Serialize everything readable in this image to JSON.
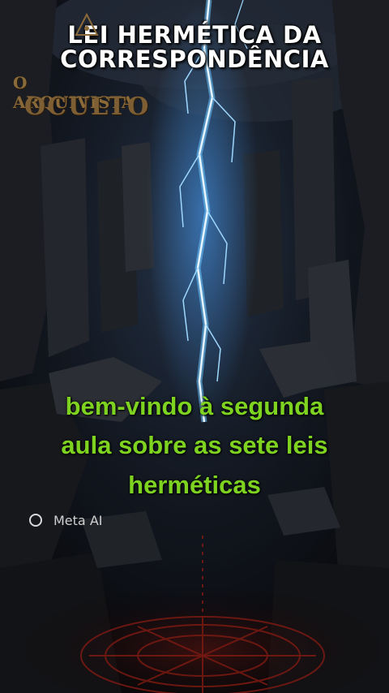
{
  "title": {
    "line1": "LEI HERMÉTICA DA",
    "line2": "CORRESPONDÊNCIA"
  },
  "logo": {
    "line1": "O ARQUIVISTA",
    "line2": "OCULTO",
    "emblem_icon": "triangle-eye-icon"
  },
  "subtitle": {
    "line1": "bem-vindo à segunda",
    "line2": "aula sobre as sete leis",
    "line3": "herméticas"
  },
  "badge": {
    "icon": "meta-ai-ring-icon",
    "label": "Meta AI"
  },
  "colors": {
    "title": "#ffffff",
    "subtitle": "#7ed321",
    "lightning": "#5fb8ff",
    "sigil": "#8a1f14",
    "logo_gold": "#8b6a3a"
  }
}
